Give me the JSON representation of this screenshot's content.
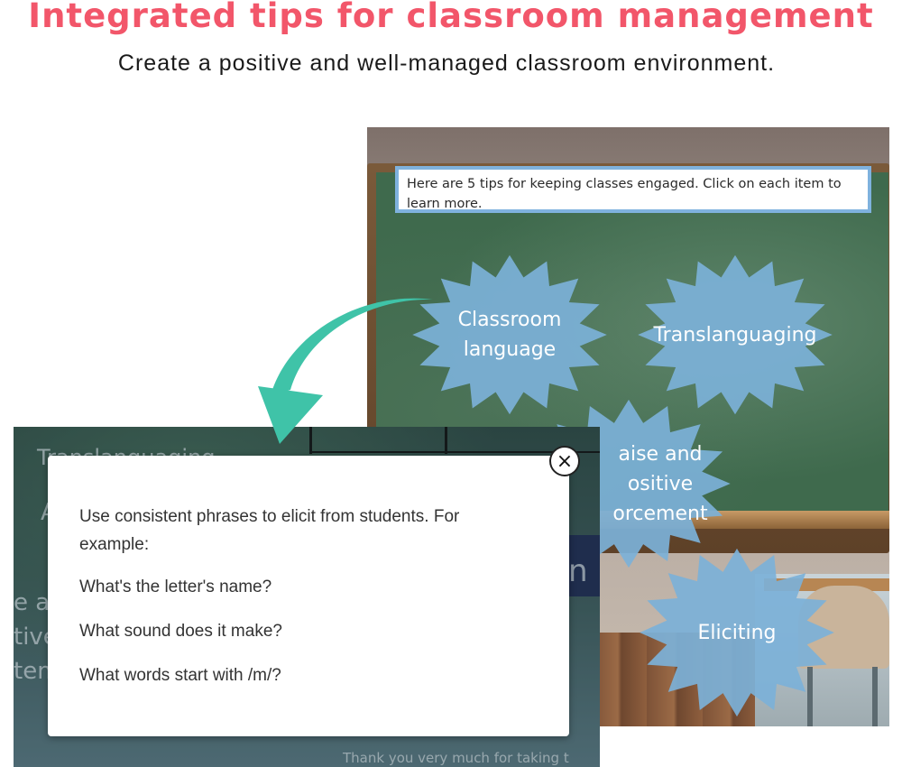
{
  "header": {
    "title": "Integrated tips for classroom management",
    "subtitle": "Create a positive and well-managed classroom environment."
  },
  "activity": {
    "instructions": "Here are 5 tips for keeping classes engaged. Click on each item to learn more.",
    "tips": [
      {
        "label_lines": [
          "Classroom",
          "language"
        ]
      },
      {
        "label_lines": [
          "Translanguaging"
        ]
      },
      {
        "label_lines": [
          "aise and",
          "ositive",
          "orcement"
        ]
      },
      {
        "label_lines": [
          "Eliciting"
        ]
      }
    ]
  },
  "popup": {
    "paragraphs": [
      "Use consistent phrases to elicit from students. For example:",
      "What's the letter's name?",
      "What sound does it make?",
      "What words start with /m/?"
    ],
    "close_glyph": "×"
  },
  "background_fragments": {
    "top_left": "Translanguaging",
    "top_left_partial": "A",
    "left_lines": [
      "e an",
      "tive",
      "tem"
    ],
    "right_char": "n",
    "bottom": "Thank you very much for taking t"
  },
  "colors": {
    "title": "#f2566a",
    "burst_fill": "#7cb1d8",
    "arrow": "#3fc3a8",
    "instruction_border": "#7fb2de"
  }
}
